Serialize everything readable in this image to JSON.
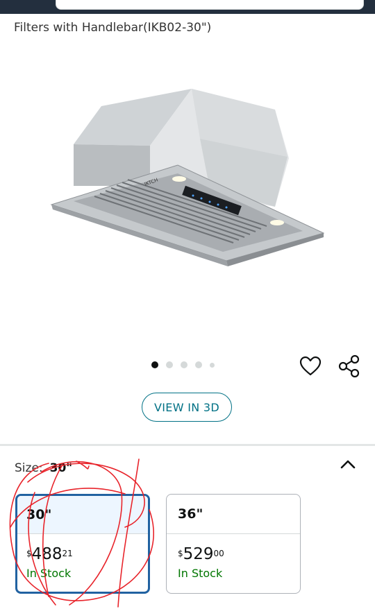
{
  "product": {
    "title": "Filters with Handlebar(IKB02-30\")"
  },
  "gallery": {
    "image_count": 5,
    "active_index": 0,
    "image_alt": "Stainless steel insert range hood",
    "brand_mark": "IKTCH"
  },
  "actions": {
    "wishlist_icon": "heart-icon",
    "share_icon": "share-icon",
    "view_3d_label": "VIEW IN 3D"
  },
  "size_selector": {
    "label": "Size:",
    "selected_value": "30\"",
    "collapse_icon": "chevron-up-icon",
    "options": [
      {
        "size": "30\"",
        "currency": "$",
        "price_whole": "488",
        "price_fraction": "21",
        "availability": "In Stock",
        "selected": true
      },
      {
        "size": "36\"",
        "currency": "$",
        "price_whole": "529",
        "price_fraction": "00",
        "availability": "In Stock",
        "selected": false
      }
    ]
  },
  "colors": {
    "link_teal": "#007185",
    "selected_border": "#2162a1",
    "in_stock_green": "#007600",
    "annotation_red": "#e8242b",
    "header_navy": "#232f3e"
  }
}
